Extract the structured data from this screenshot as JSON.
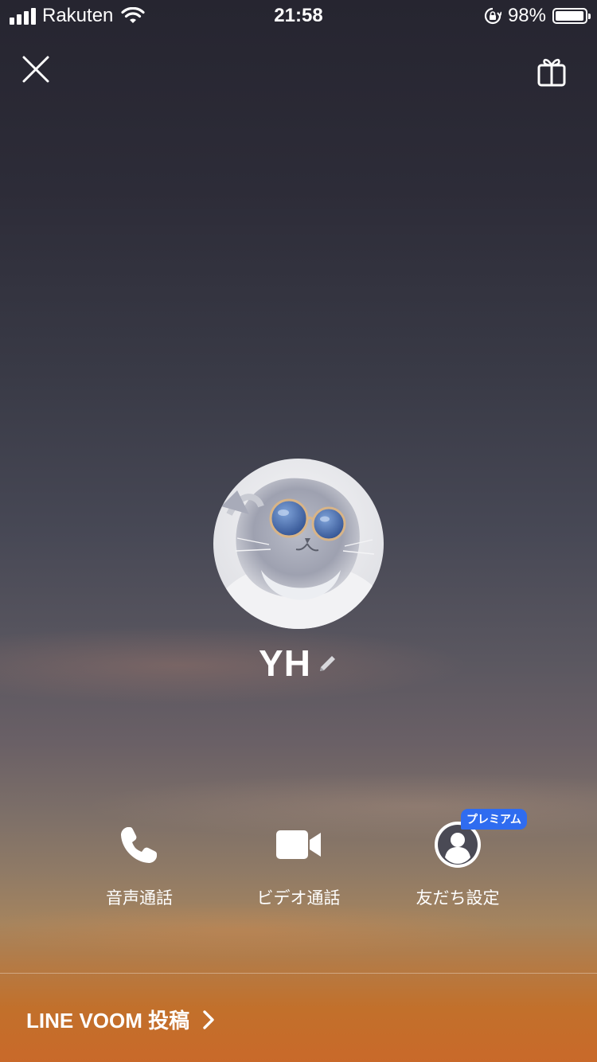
{
  "status_bar": {
    "carrier": "Rakuten",
    "time": "21:58",
    "battery_percent": "98%",
    "battery_level": 0.98
  },
  "profile": {
    "name": "YH"
  },
  "actions": [
    {
      "label": "音声通話",
      "icon": "phone-icon"
    },
    {
      "label": "ビデオ通話",
      "icon": "video-camera-icon"
    },
    {
      "label": "友だち設定",
      "icon": "person-icon",
      "badge": "プレミアム"
    }
  ],
  "footer": {
    "voom_link": "LINE VOOM 投稿"
  },
  "colors": {
    "premium_badge": "#2f6cf0",
    "sky_top": "#262530",
    "sky_bottom": "#c9692a"
  }
}
